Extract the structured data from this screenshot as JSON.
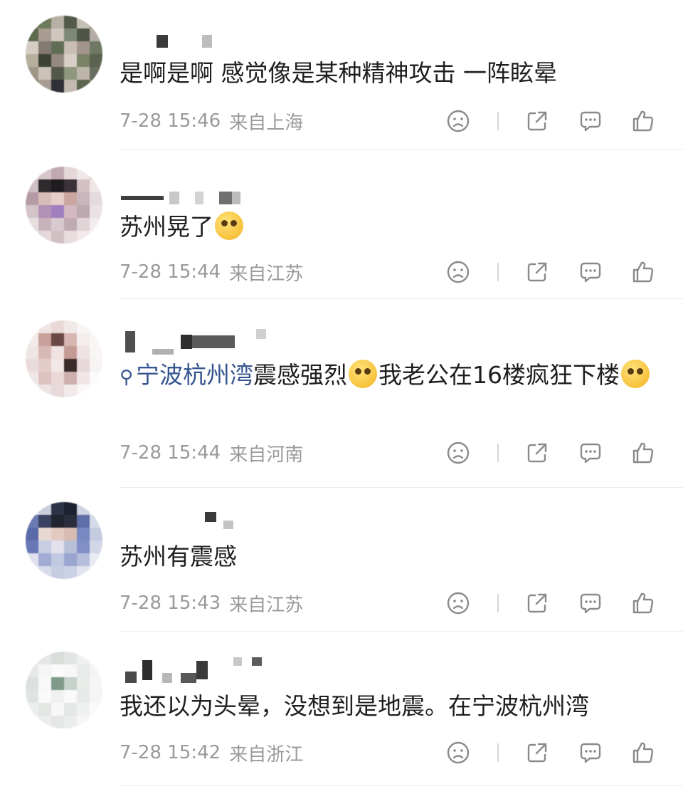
{
  "comments": [
    {
      "text": "是啊是啊 感觉像是某种精神攻击 一阵眩晕",
      "time": "7-28 15:46",
      "location": "来自上海",
      "emoji": "",
      "topic": "",
      "text_after": ""
    },
    {
      "text": "苏州晃了",
      "time": "7-28 15:44",
      "location": "来自江苏",
      "emoji": "surprised-face-emoji",
      "topic": "",
      "text_after": ""
    },
    {
      "text": "震感强烈",
      "time": "7-28 15:44",
      "location": "来自河南",
      "emoji": "laughing-crying-face-emoji",
      "topic": "宁波杭州湾",
      "text_after": "我老公在16楼疯狂下楼"
    },
    {
      "text": "苏州有震感",
      "time": "7-28 15:43",
      "location": "来自江苏",
      "emoji": "",
      "topic": "",
      "text_after": ""
    },
    {
      "text": "我还以为头晕，没想到是地震。在宁波杭州湾",
      "time": "7-28 15:42",
      "location": "来自浙江",
      "emoji": "",
      "topic": "",
      "text_after": ""
    }
  ],
  "icons": {
    "dislike": "sad-face-icon",
    "share": "share-icon",
    "reply": "comment-bubble-icon",
    "like": "thumbs-up-icon"
  },
  "colors": {
    "topic_link": "#36558f",
    "meta_text": "#9a9a9a"
  }
}
